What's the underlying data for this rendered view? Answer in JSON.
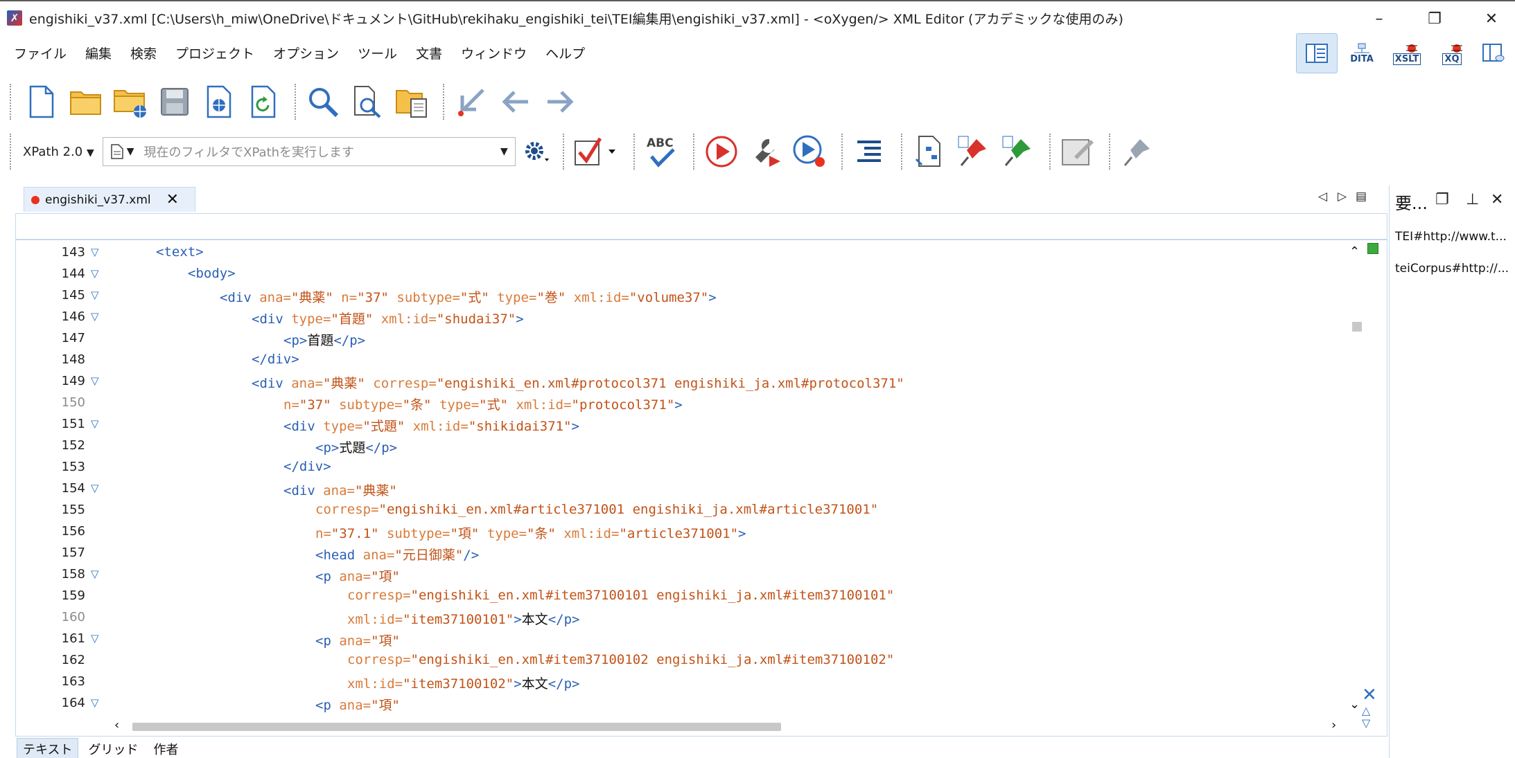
{
  "window": {
    "title": "engishiki_v37.xml [C:\\Users\\h_miw\\OneDrive\\ドキュメント\\GitHub\\rekihaku_engishiki_tei\\TEI編集用\\engishiki_v37.xml] - <oXygen/> XML Editor (アカデミックな使用のみ)",
    "minimize": "–",
    "maximize": "❐",
    "close": "✕"
  },
  "menu": [
    "ファイル",
    "編集",
    "検索",
    "プロジェクト",
    "オプション",
    "ツール",
    "文書",
    "ウィンドウ",
    "ヘルプ"
  ],
  "perspectives": [
    {
      "label": ""
    },
    {
      "label": "DITA"
    },
    {
      "label": "XSLT"
    },
    {
      "label": "XQ"
    },
    {
      "label": ""
    }
  ],
  "xpath": {
    "version": "XPath 2.0",
    "placeholder": "現在のフィルタでXPathを実行します"
  },
  "editor_tab": {
    "label": "engishiki_v37.xml",
    "close": "✕"
  },
  "lines": [
    {
      "n": "143",
      "fold": true
    },
    {
      "n": "144",
      "fold": true
    },
    {
      "n": "145",
      "fold": true
    },
    {
      "n": "146",
      "fold": true
    },
    {
      "n": "147",
      "fold": false
    },
    {
      "n": "148",
      "fold": false
    },
    {
      "n": "149",
      "fold": true
    },
    {
      "n": "150",
      "fold": false,
      "dim": true
    },
    {
      "n": "151",
      "fold": true
    },
    {
      "n": "152",
      "fold": false
    },
    {
      "n": "153",
      "fold": false
    },
    {
      "n": "154",
      "fold": true
    },
    {
      "n": "155",
      "fold": false
    },
    {
      "n": "156",
      "fold": false
    },
    {
      "n": "157",
      "fold": false
    },
    {
      "n": "158",
      "fold": true
    },
    {
      "n": "159",
      "fold": false
    },
    {
      "n": "160",
      "fold": false,
      "dim": true
    },
    {
      "n": "161",
      "fold": true
    },
    {
      "n": "162",
      "fold": false
    },
    {
      "n": "163",
      "fold": false
    },
    {
      "n": "164",
      "fold": true
    }
  ],
  "code": {
    "l143_tag": "<text>",
    "l144_tag": "<body>",
    "l145_open": "<div ",
    "l145_a1": "ana=",
    "l145_v1": "\"典薬\"",
    "l145_a2": " n=",
    "l145_v2": "\"37\"",
    "l145_a3": " subtype=",
    "l145_v3": "\"式\"",
    "l145_a4": " type=",
    "l145_v4": "\"巻\"",
    "l145_a5": " xml:id=",
    "l145_v5": "\"volume37\"",
    "l145_close": ">",
    "l146_open": "<div ",
    "l146_a1": "type=",
    "l146_v1": "\"首題\"",
    "l146_a2": " xml:id=",
    "l146_v2": "\"shudai37\"",
    "l146_close": ">",
    "l147_open": "<p>",
    "l147_text": "首題",
    "l147_close": "</p>",
    "l148_tag": "</div>",
    "l149_open": "<div ",
    "l149_a1": "ana=",
    "l149_v1": "\"典薬\"",
    "l149_a2": " corresp=",
    "l149_v2": "\"engishiki_en.xml#protocol371 engishiki_ja.xml#protocol371\"",
    "l150_a1": "n=",
    "l150_v1": "\"37\"",
    "l150_a2": " subtype=",
    "l150_v2": "\"条\"",
    "l150_a3": " type=",
    "l150_v3": "\"式\"",
    "l150_a4": " xml:id=",
    "l150_v4": "\"protocol371\"",
    "l150_close": ">",
    "l151_open": "<div ",
    "l151_a1": "type=",
    "l151_v1": "\"式題\"",
    "l151_a2": " xml:id=",
    "l151_v2": "\"shikidai371\"",
    "l151_close": ">",
    "l152_open": "<p>",
    "l152_text": "式題",
    "l152_close": "</p>",
    "l153_tag": "</div>",
    "l154_open": "<div ",
    "l154_a1": "ana=",
    "l154_v1": "\"典薬\"",
    "l155_a1": "corresp=",
    "l155_v1": "\"engishiki_en.xml#article371001 engishiki_ja.xml#article371001\"",
    "l156_a1": "n=",
    "l156_v1": "\"37.1\"",
    "l156_a2": " subtype=",
    "l156_v2": "\"項\"",
    "l156_a3": " type=",
    "l156_v3": "\"条\"",
    "l156_a4": " xml:id=",
    "l156_v4": "\"article371001\"",
    "l156_close": ">",
    "l157_open": "<head ",
    "l157_a1": "ana=",
    "l157_v1": "\"元日御薬\"",
    "l157_close": "/>",
    "l158_open": "<p ",
    "l158_a1": "ana=",
    "l158_v1": "\"項\"",
    "l159_a1": "corresp=",
    "l159_v1": "\"engishiki_en.xml#item37100101 engishiki_ja.xml#item37100101\"",
    "l160_a1": "xml:id=",
    "l160_v1": "\"item37100101\"",
    "l160_gt": ">",
    "l160_text": "本文",
    "l160_close": "</p>",
    "l161_open": "<p ",
    "l161_a1": "ana=",
    "l161_v1": "\"項\"",
    "l162_a1": "corresp=",
    "l162_v1": "\"engishiki_en.xml#item37100102 engishiki_ja.xml#item37100102\"",
    "l163_a1": "xml:id=",
    "l163_v1": "\"item37100102\"",
    "l163_gt": ">",
    "l163_text": "本文",
    "l163_close": "</p>",
    "l164_open": "<p ",
    "l164_a1": "ana=",
    "l164_v1": "\"項\""
  },
  "mode_tabs": [
    "テキスト",
    "グリッド",
    "作者"
  ],
  "right_panel": {
    "title": "要...",
    "items": [
      "TEI#http://www.t...",
      "teiCorpus#http://..."
    ]
  },
  "colors": {
    "tag": "#2a5fb5",
    "attr": "#d87b3a",
    "value": "#c25318",
    "modified_dot": "#e8321e",
    "accent": "#d9e8f7"
  }
}
